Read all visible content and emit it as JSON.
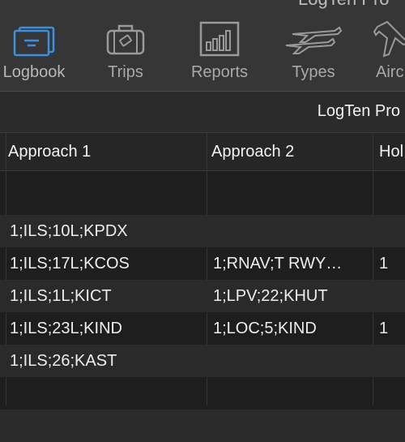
{
  "window": {
    "title": "LogTen Pro"
  },
  "toolbar": {
    "items": [
      {
        "label": "Logbook",
        "icon": "logbook-icon",
        "active": true
      },
      {
        "label": "Trips",
        "icon": "suitcase-icon"
      },
      {
        "label": "Reports",
        "icon": "bar-chart-icon"
      },
      {
        "label": "Types",
        "icon": "airplanes-icon"
      },
      {
        "label": "Airc",
        "icon": "airplane-icon"
      }
    ]
  },
  "subbar": {
    "title": "LogTen Pro"
  },
  "table": {
    "columns": [
      "Approach 1",
      "Approach 2",
      "Hol"
    ],
    "rows": [
      [
        "",
        "",
        ""
      ],
      [
        "1;ILS;10L;KPDX",
        "",
        ""
      ],
      [
        "1;ILS;17L;KCOS",
        "1;RNAV;T RWY…",
        "1"
      ],
      [
        "1;ILS;1L;KICT",
        "1;LPV;22;KHUT",
        ""
      ],
      [
        "1;ILS;23L;KIND",
        "1;LOC;5;KIND",
        "1"
      ],
      [
        "1;ILS;26;KAST",
        "",
        ""
      ],
      [
        "",
        "",
        ""
      ],
      [
        "",
        "",
        ""
      ]
    ]
  },
  "colors": {
    "accent": "#3b8fe0",
    "background": "#1e1e1e",
    "toolbar": "#363636"
  }
}
